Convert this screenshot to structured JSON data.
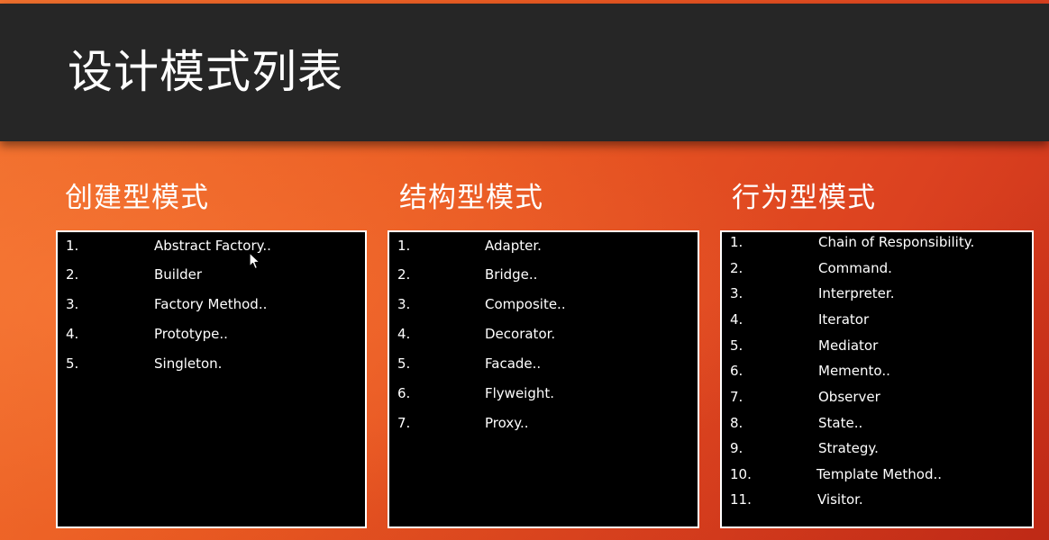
{
  "slide": {
    "title": "设计模式列表"
  },
  "columns": [
    {
      "heading": "创建型模式",
      "items": [
        {
          "num": "1.",
          "label": "Abstract Factory.."
        },
        {
          "num": "2.",
          "label": "Builder"
        },
        {
          "num": "3.",
          "label": "Factory Method.."
        },
        {
          "num": "4.",
          "label": "Prototype.."
        },
        {
          "num": "5.",
          "label": "Singleton."
        }
      ]
    },
    {
      "heading": "结构型模式",
      "items": [
        {
          "num": "1.",
          "label": "Adapter."
        },
        {
          "num": "2.",
          "label": "Bridge.."
        },
        {
          "num": "3.",
          "label": "Composite.."
        },
        {
          "num": "4.",
          "label": "Decorator."
        },
        {
          "num": "5.",
          "label": "Facade.."
        },
        {
          "num": "6.",
          "label": "Flyweight."
        },
        {
          "num": "7.",
          "label": "Proxy.."
        }
      ]
    },
    {
      "heading": "行为型模式",
      "items": [
        {
          "num": "1.",
          "label": "Chain of Responsibility."
        },
        {
          "num": "2.",
          "label": "Command."
        },
        {
          "num": "3.",
          "label": "Interpreter."
        },
        {
          "num": "4.",
          "label": "Iterator"
        },
        {
          "num": "5.",
          "label": "Mediator"
        },
        {
          "num": "6.",
          "label": "Memento.."
        },
        {
          "num": "7.",
          "label": "Observer"
        },
        {
          "num": "8.",
          "label": "State.."
        },
        {
          "num": "9.",
          "label": "Strategy."
        },
        {
          "num": "10.",
          "label": "Template Method.."
        },
        {
          "num": "11.",
          "label": "Visitor."
        }
      ]
    }
  ],
  "colors": {
    "title_bar": "#262626",
    "background_accent": "#ea5a22",
    "panel": "#000000",
    "text": "#ffffff"
  },
  "icons": {
    "cursor": "mouse-pointer-icon"
  }
}
